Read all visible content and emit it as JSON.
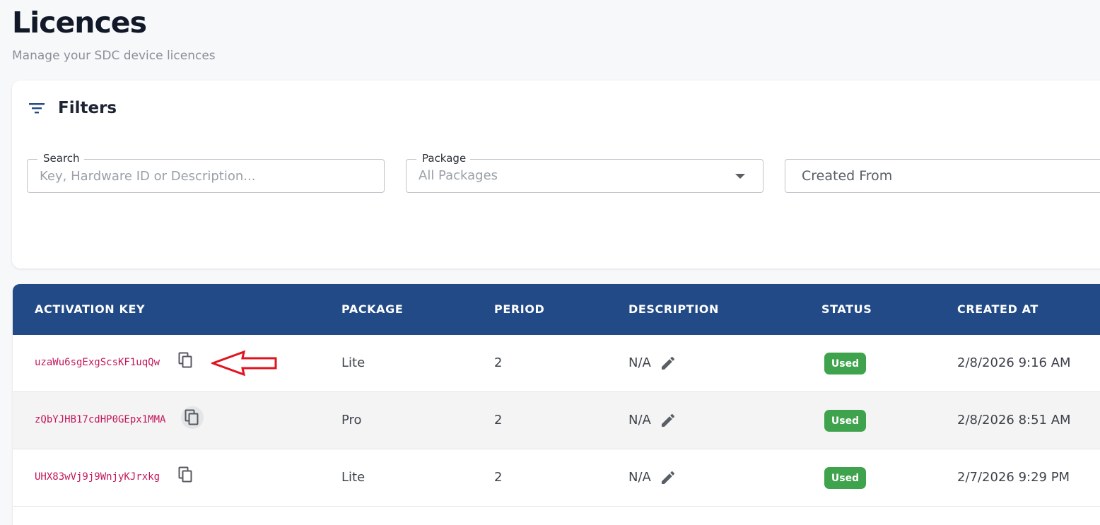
{
  "header": {
    "title": "Licences",
    "subtitle": "Manage your SDC device licences"
  },
  "filters": {
    "title": "Filters",
    "search": {
      "label": "Search",
      "placeholder": "Key, Hardware ID or Description...",
      "value": ""
    },
    "package": {
      "label": "Package",
      "value": "All Packages"
    },
    "created_from": {
      "label": "Created From"
    }
  },
  "table": {
    "columns": [
      "ACTIVATION KEY",
      "PACKAGE",
      "PERIOD",
      "DESCRIPTION",
      "STATUS",
      "CREATED AT"
    ],
    "rows": [
      {
        "key": "uzaWu6sgExgScsKF1uqQw",
        "package": "Lite",
        "period": "2",
        "description": "N/A",
        "status": "Used",
        "created_at": "2/8/2026 9:16 AM"
      },
      {
        "key": "zQbYJHB17cdHP0GEpx1MMA",
        "package": "Pro",
        "period": "2",
        "description": "N/A",
        "status": "Used",
        "created_at": "2/8/2026 8:51 AM"
      },
      {
        "key": "UHX83wVj9j9WnjyKJrxkg",
        "package": "Lite",
        "period": "2",
        "description": "N/A",
        "status": "Used",
        "created_at": "2/7/2026 9:29 PM"
      }
    ]
  },
  "icons": {
    "filter": "filter-lines-icon",
    "copy": "copy-icon",
    "edit": "pencil-icon",
    "caret": "caret-down-icon",
    "annotation": "red-arrow-annotation"
  },
  "colors": {
    "header_bg": "#214a86",
    "key_text": "#c2185b",
    "status_used": "#3fa34d",
    "annotation": "#e0141e"
  }
}
